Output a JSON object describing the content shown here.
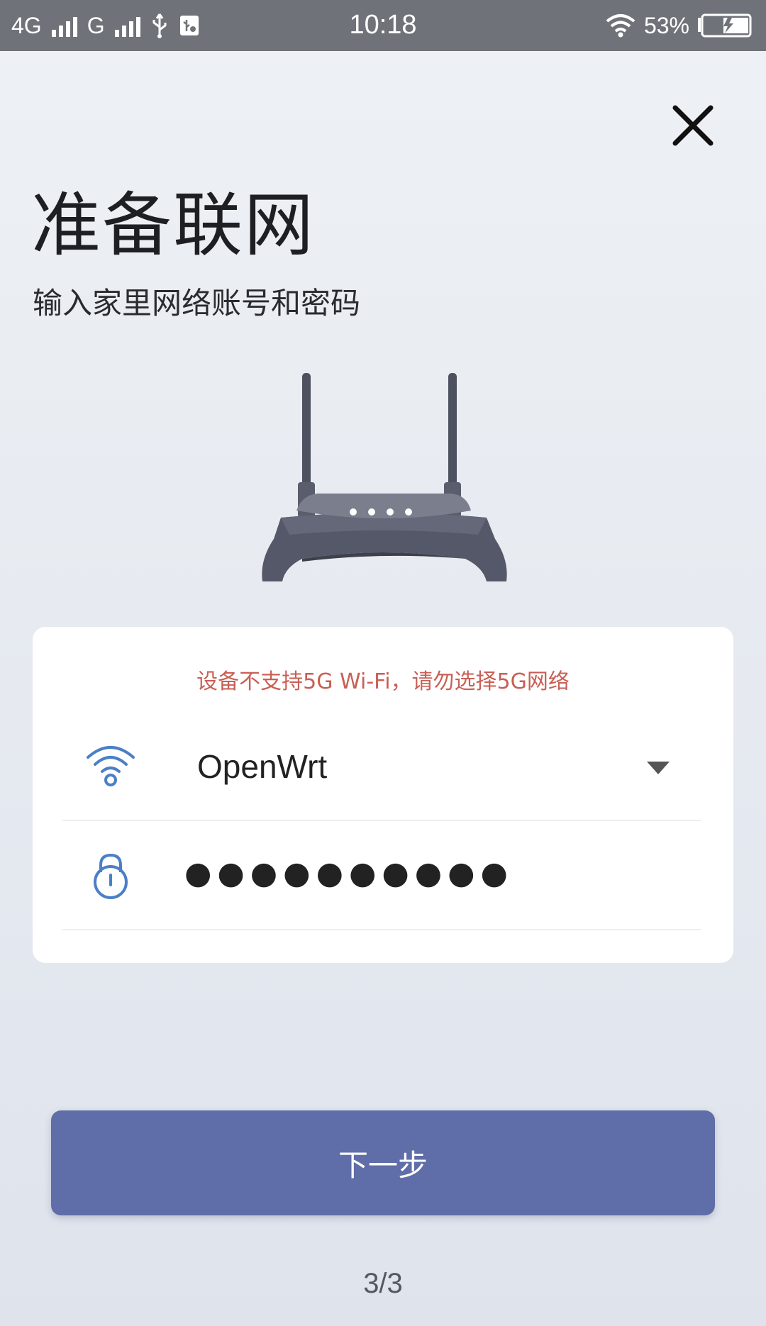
{
  "status_bar": {
    "network_1": "4G",
    "network_2": "G",
    "time": "10:18",
    "battery_percent": "53%"
  },
  "title": "准备联网",
  "subtitle": "输入家里网络账号和密码",
  "form": {
    "warning": "设备不支持5G Wi-Fi，请勿选择5G网络",
    "ssid": "OpenWrt",
    "password_mask": "●●●●●●●●●●"
  },
  "next_button_label": "下一步",
  "page_indicator": "3/3",
  "colors": {
    "primary": "#5f6da8",
    "warning": "#c95f55",
    "icon": "#4b7fc6"
  },
  "icons": [
    "close-icon",
    "router-illustration",
    "wifi-icon",
    "chevron-down-icon",
    "lock-icon"
  ]
}
